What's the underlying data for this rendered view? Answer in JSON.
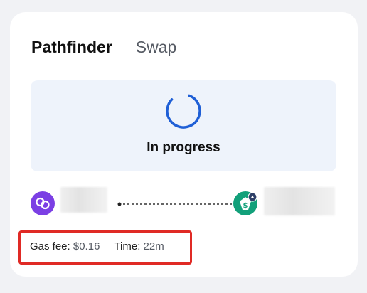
{
  "tabs": [
    {
      "label": "Pathfinder",
      "active": true
    },
    {
      "label": "Swap",
      "active": false
    }
  ],
  "status": {
    "text": "In progress",
    "spinner_color": "#1f5fd6"
  },
  "route": {
    "from_token": {
      "icon": "chain-link-icon",
      "color": "#7b3fe4"
    },
    "to_token": {
      "icon": "dollar-tag-icon",
      "color": "#12a07a"
    }
  },
  "meta": {
    "gas_fee_label": "Gas fee:",
    "gas_fee_value": "$0.16",
    "time_label": "Time:",
    "time_value": "22m"
  },
  "highlight_color": "#e02a25"
}
